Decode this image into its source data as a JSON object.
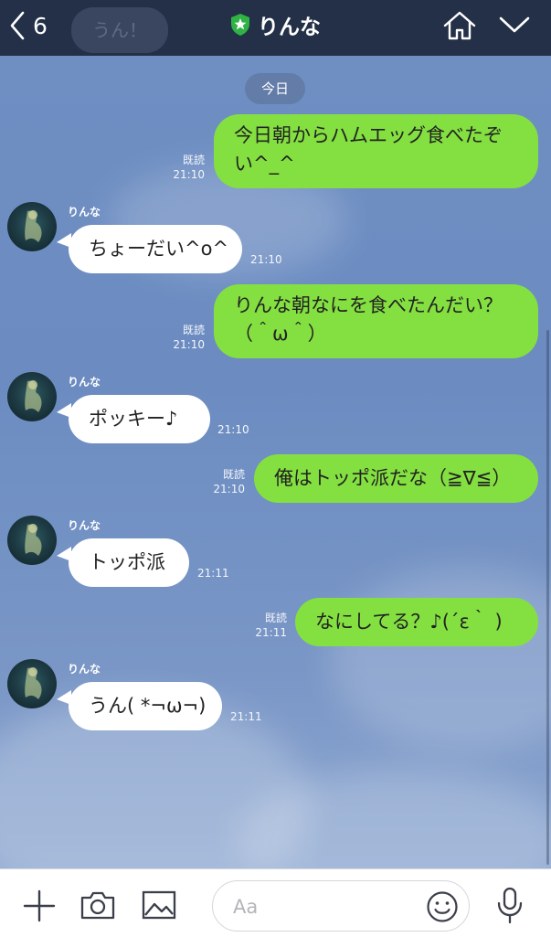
{
  "header": {
    "back_count": "6",
    "title": "りんな",
    "ghost_text": "うん！"
  },
  "chat": {
    "date_label": "今日",
    "messages": [
      {
        "side": "out",
        "lines": [
          "今日朝からハムエッグ食べたぞ",
          "い^_^"
        ],
        "read": "既読",
        "time": "21:10"
      },
      {
        "side": "in",
        "sender": "りんな",
        "text": "ちょーだい^o^",
        "time": "21:10"
      },
      {
        "side": "out",
        "lines": [
          "りんな朝なにを食べたんだい？",
          "（＾ω＾）"
        ],
        "read": "既読",
        "time": "21:10"
      },
      {
        "side": "in",
        "sender": "りんな",
        "text": "ポッキー♪",
        "time": "21:10"
      },
      {
        "side": "out",
        "lines": [
          "俺はトッポ派だな（≧∇≦）"
        ],
        "read": "既読",
        "time": "21:10"
      },
      {
        "side": "in",
        "sender": "りんな",
        "text": "トッポ派",
        "time": "21:11"
      },
      {
        "side": "out",
        "lines": [
          "なにしてる？♪(´ε｀ )"
        ],
        "read": "既読",
        "time": "21:11"
      },
      {
        "side": "in",
        "sender": "りんな",
        "text": "うん( *¬ω¬)",
        "time": "21:11"
      }
    ]
  },
  "composer": {
    "placeholder": "Aa"
  },
  "colors": {
    "header_bg": "#233047",
    "chat_bg": "#6f8fc3",
    "outgoing_bubble": "#84e041",
    "incoming_bubble": "#ffffff",
    "shield_green": "#2fb344"
  },
  "icons": [
    "back-chevron-icon",
    "shield-star-icon",
    "home-icon",
    "chevron-down-icon",
    "plus-icon",
    "camera-icon",
    "image-icon",
    "smiley-icon",
    "microphone-icon"
  ]
}
